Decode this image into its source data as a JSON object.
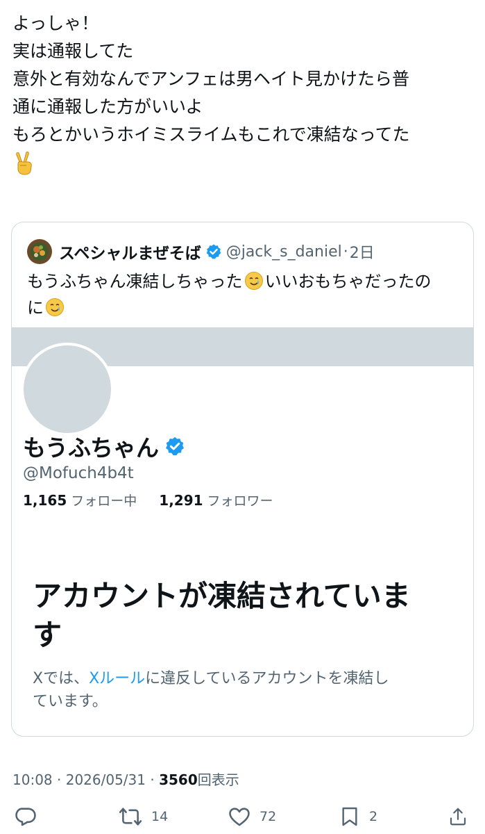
{
  "tweet": {
    "lines": [
      "よっしゃ！",
      "実は通報してた",
      "意外と有効なんでアンフェは男ヘイト見かけたら普",
      "通に通報した方がいいよ",
      "もろとかいうホイミスライムもこれで凍結なってた"
    ],
    "trailing_emoji": "victory-hand"
  },
  "quote": {
    "author_name": "スペシャルまぜそば",
    "author_handle": "@jack_s_daniel",
    "separator": "·",
    "time": "2日",
    "text_line1_a": "もうふちゃん凍結しちゃった",
    "text_line1_b": "いいおもちゃだったの",
    "text_line2": "に",
    "emoji": "smiling-face-with-tear"
  },
  "profile_card": {
    "name": "もうふちゃん",
    "handle": "@Mofuch4b4t",
    "following_count": "1,165",
    "following_label": "フォロー中",
    "followers_count": "1,291",
    "followers_label": "フォロワー",
    "suspended_title_line1": "アカウントが凍結されていま",
    "suspended_title_line2": "す",
    "desc_prefix": "Xでは、",
    "desc_link": "Xルール",
    "desc_mid": "に違反しているアカウントを凍結し",
    "desc_line2": "ています。"
  },
  "meta": {
    "time": "10:08",
    "separator": "·",
    "date": "2026/05/31",
    "views_count": "3560",
    "views_label": "回表示"
  },
  "actions": {
    "reply_count": "",
    "retweet_count": "14",
    "like_count": "72",
    "bookmark_count": "2"
  },
  "colors": {
    "text": "#0f1419",
    "secondary": "#536471",
    "link": "#1d9bf0",
    "verified": "#1d9bf0",
    "border": "#cfd9de",
    "banner": "#cfd9de"
  }
}
